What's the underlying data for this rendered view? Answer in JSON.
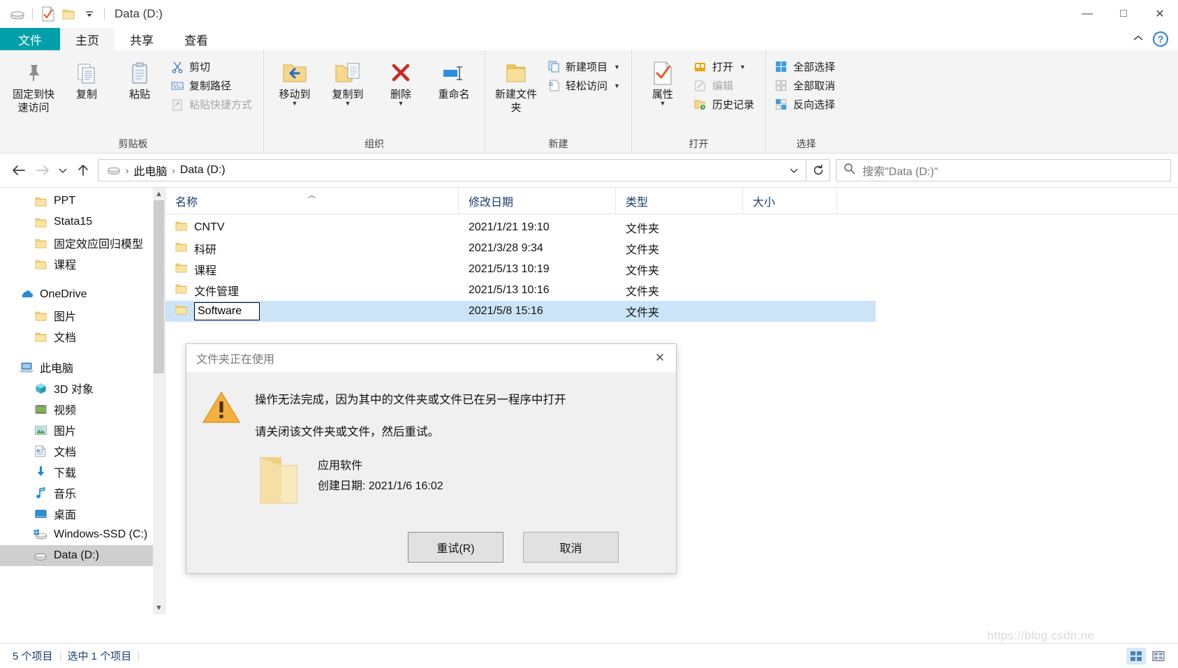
{
  "window": {
    "title": "Data (D:)",
    "quick_access_icons": [
      "drive-icon",
      "properties-icon",
      "new-folder-icon",
      "customize-caret-icon"
    ],
    "controls": {
      "minimize": "—",
      "maximize": "□",
      "close": "✕"
    }
  },
  "ribbon": {
    "tabs": [
      {
        "label": "文件",
        "kind": "file"
      },
      {
        "label": "主页",
        "kind": "active"
      },
      {
        "label": "共享",
        "kind": "normal"
      },
      {
        "label": "查看",
        "kind": "normal"
      }
    ],
    "collapse_icon": "chevron-up-icon",
    "help_icon": "help-icon",
    "groups": [
      {
        "label": "剪贴板",
        "big": [
          {
            "label": "固定到快速访问",
            "icon": "pin-icon"
          },
          {
            "label": "复制",
            "icon": "copy-icon"
          },
          {
            "label": "粘贴",
            "icon": "paste-icon"
          }
        ],
        "small": [
          {
            "label": "剪切",
            "icon": "scissors-icon",
            "disabled": false
          },
          {
            "label": "复制路径",
            "icon": "copy-path-icon",
            "disabled": false
          },
          {
            "label": "粘贴快捷方式",
            "icon": "paste-shortcut-icon",
            "disabled": true
          }
        ]
      },
      {
        "label": "组织",
        "big": [
          {
            "label": "移动到",
            "icon": "move-to-icon",
            "has_caret": true
          },
          {
            "label": "复制到",
            "icon": "copy-to-icon",
            "has_caret": true
          },
          {
            "label": "删除",
            "icon": "delete-icon",
            "has_caret": true
          },
          {
            "label": "重命名",
            "icon": "rename-icon",
            "has_caret": false
          }
        ],
        "small": []
      },
      {
        "label": "新建",
        "big": [
          {
            "label": "新建文件夹",
            "icon": "new-folder-icon"
          }
        ],
        "small": [
          {
            "label": "新建项目",
            "icon": "new-item-icon",
            "has_caret": true,
            "disabled": false
          },
          {
            "label": "轻松访问",
            "icon": "easy-access-icon",
            "has_caret": true,
            "disabled": false
          }
        ]
      },
      {
        "label": "打开",
        "big": [
          {
            "label": "属性",
            "icon": "properties-icon",
            "has_caret": true
          }
        ],
        "small": [
          {
            "label": "打开",
            "icon": "open-icon",
            "has_caret": true,
            "disabled": false
          },
          {
            "label": "编辑",
            "icon": "edit-icon",
            "disabled": true
          },
          {
            "label": "历史记录",
            "icon": "history-icon",
            "disabled": false
          }
        ]
      },
      {
        "label": "选择",
        "big": [],
        "small": [
          {
            "label": "全部选择",
            "icon": "select-all-icon",
            "disabled": false
          },
          {
            "label": "全部取消",
            "icon": "select-none-icon",
            "disabled": false
          },
          {
            "label": "反向选择",
            "icon": "invert-selection-icon",
            "disabled": false
          }
        ]
      }
    ]
  },
  "address": {
    "back_icon": "back-arrow-icon",
    "forward_icon": "forward-arrow-icon",
    "recent_icon": "chevron-down-icon",
    "up_icon": "up-arrow-icon",
    "breadcrumb": [
      "此电脑",
      "Data (D:)"
    ],
    "dropdown_caret": "chevron-down-icon",
    "refresh_icon": "refresh-icon"
  },
  "search": {
    "icon": "search-icon",
    "placeholder": "搜索\"Data (D:)\""
  },
  "sidebar": {
    "items": [
      {
        "label": "PPT",
        "icon": "folder-icon",
        "level": 2,
        "selected": false
      },
      {
        "label": "Stata15",
        "icon": "folder-icon",
        "level": 2,
        "selected": false
      },
      {
        "label": "固定效应回归模型",
        "icon": "folder-icon",
        "level": 2,
        "selected": false
      },
      {
        "label": "课程",
        "icon": "folder-icon",
        "level": 2,
        "selected": false
      },
      {
        "label": "",
        "icon": "spacer",
        "level": 0,
        "selected": false
      },
      {
        "label": "OneDrive",
        "icon": "onedrive-icon",
        "level": 1,
        "selected": false
      },
      {
        "label": "图片",
        "icon": "folder-icon",
        "level": 2,
        "selected": false
      },
      {
        "label": "文档",
        "icon": "folder-icon",
        "level": 2,
        "selected": false
      },
      {
        "label": "",
        "icon": "spacer",
        "level": 0,
        "selected": false
      },
      {
        "label": "此电脑",
        "icon": "this-pc-icon",
        "level": 1,
        "selected": false
      },
      {
        "label": "3D 对象",
        "icon": "3d-objects-icon",
        "level": 2,
        "selected": false
      },
      {
        "label": "视频",
        "icon": "videos-icon",
        "level": 2,
        "selected": false
      },
      {
        "label": "图片",
        "icon": "pictures-icon",
        "level": 2,
        "selected": false
      },
      {
        "label": "文档",
        "icon": "documents-icon",
        "level": 2,
        "selected": false
      },
      {
        "label": "下载",
        "icon": "downloads-icon",
        "level": 2,
        "selected": false
      },
      {
        "label": "音乐",
        "icon": "music-icon",
        "level": 2,
        "selected": false
      },
      {
        "label": "桌面",
        "icon": "desktop-icon",
        "level": 2,
        "selected": false
      },
      {
        "label": "Windows-SSD (C:)",
        "icon": "windows-drive-icon",
        "level": 2,
        "selected": false
      },
      {
        "label": "Data (D:)",
        "icon": "drive-icon",
        "level": 2,
        "selected": true
      }
    ]
  },
  "filelist": {
    "columns": [
      {
        "label": "名称",
        "key": "name",
        "sorted": "asc"
      },
      {
        "label": "修改日期",
        "key": "date",
        "sorted": ""
      },
      {
        "label": "类型",
        "key": "type",
        "sorted": ""
      },
      {
        "label": "大小",
        "key": "size",
        "sorted": ""
      }
    ],
    "rows": [
      {
        "name": "CNTV",
        "date": "2021/1/21 19:10",
        "type": "文件夹",
        "size": "",
        "selected": false,
        "renaming": false
      },
      {
        "name": "科研",
        "date": "2021/3/28 9:34",
        "type": "文件夹",
        "size": "",
        "selected": false,
        "renaming": false
      },
      {
        "name": "课程",
        "date": "2021/5/13 10:19",
        "type": "文件夹",
        "size": "",
        "selected": false,
        "renaming": false
      },
      {
        "name": "文件管理",
        "date": "2021/5/13 10:16",
        "type": "文件夹",
        "size": "",
        "selected": false,
        "renaming": false
      },
      {
        "name": "Software",
        "date": "2021/5/8 15:16",
        "type": "文件夹",
        "size": "",
        "selected": true,
        "renaming": true
      }
    ]
  },
  "statusbar": {
    "item_count": "5 个项目",
    "selection": "选中 1 个项目",
    "view_details_icon": "details-view-icon",
    "view_large_icon": "large-icons-view-icon"
  },
  "watermark": "https://blog.csdn.ne",
  "dialog": {
    "title": "文件夹正在使用",
    "close_icon": "close-icon",
    "warning_icon": "warning-triangle-icon",
    "message_primary": "操作无法完成，因为其中的文件夹或文件已在另一程序中打开",
    "message_secondary": "请关闭该文件夹或文件，然后重试。",
    "detail_icon": "folder-large-icon",
    "detail_name": "应用软件",
    "detail_created": "创建日期: 2021/1/6 16:02",
    "buttons": [
      {
        "label": "重试(R)",
        "name": "retry-button"
      },
      {
        "label": "取消",
        "name": "cancel-button"
      }
    ]
  },
  "colors": {
    "file_tab": "#009faa",
    "selection": "#cce4f7",
    "folder_yellow": "#f5d67e",
    "accent_blue": "#1f7fd4"
  }
}
